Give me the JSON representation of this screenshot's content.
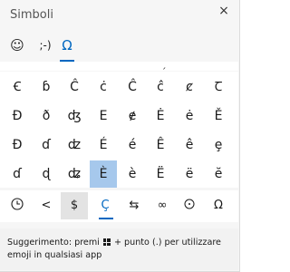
{
  "window": {
    "title": "Simboli",
    "close_label": "×"
  },
  "tabs": [
    {
      "label": "☺",
      "name": "emoji"
    },
    {
      "label": ";-)",
      "name": "kaomoji"
    },
    {
      "label": "Ω",
      "name": "symbols"
    }
  ],
  "partial_row": [
    "ˋ",
    "ˏ"
  ],
  "grid": [
    [
      "Ꞓ",
      "ɓ",
      "Ĉ",
      "ċ",
      "Ĉ",
      "ĉ",
      "ȼ",
      "Ꞇ"
    ],
    [
      "Đ",
      "ð",
      "ʤ",
      "Е",
      "ɇ",
      "Ė",
      "ė",
      "Ě"
    ],
    [
      "Đ",
      "ɗ",
      "ʣ",
      "É",
      "é",
      "Ê",
      "ê",
      "ȩ"
    ],
    [
      "ɗ",
      "ɖ",
      "ʥ",
      "È",
      "è",
      "Ë",
      "ë",
      "ĕ"
    ]
  ],
  "selected_cell": "È",
  "bottom_bar": [
    {
      "label": "🕓",
      "name": "recent"
    },
    {
      "label": "<",
      "name": "math"
    },
    {
      "label": "$",
      "name": "currency"
    },
    {
      "label": "Ç",
      "name": "latin"
    },
    {
      "label": "⇆",
      "name": "arrows"
    },
    {
      "label": "∞",
      "name": "math-symbols"
    },
    {
      "label": "⨀",
      "name": "geometric"
    },
    {
      "label": "Ω",
      "name": "language"
    }
  ],
  "tip": {
    "prefix": "Suggerimento: premi ",
    "suffix": " + punto (.) per utilizzare emoji in qualsiasi app"
  },
  "colors": {
    "accent": "#0067c0",
    "selected_cell": "#a6c8ec",
    "panel_bg": "#f6f6f6",
    "grid_bg": "#ffffff"
  }
}
